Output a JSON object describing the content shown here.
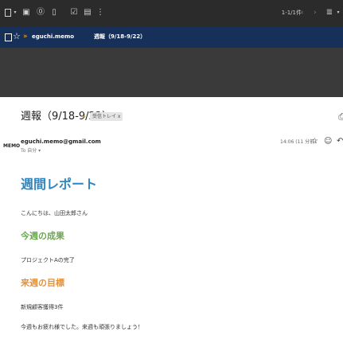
{
  "toolbar": {
    "pager_text": "1-1/1件",
    "prev_icon": "chevron-left-icon",
    "next_icon": "chevron-right-icon",
    "density_icon": "view-density-icon"
  },
  "selected_row": {
    "sender": "eguchi.memo",
    "subject": "週報（9/18-9/22）",
    "importance_marker": "»"
  },
  "email": {
    "subject": "週報（9/18-9/22）",
    "label_chip": "受信トレイ x",
    "importance_marker": "»",
    "avatar_text": "MEMO",
    "sender_email": "eguchi.memo@gmail.com",
    "to_line": "To 自分 ▾",
    "time": "14:06 (11 分前)",
    "body": {
      "heading": "週間レポート",
      "greeting": "こんにちは、山田太郎さん",
      "section1_heading": "今週の成果",
      "section1_text": "プロジェクトAの完了",
      "section2_heading": "来週の目標",
      "section2_text": "新規顧客獲得3件",
      "closing": "今週もお疲れ様でした。来週も頑張りましょう！"
    }
  },
  "colors": {
    "toolbar_bg": "#2b2b2b",
    "selected_row_bg": "#17305a",
    "heading_blue": "#2e86c1",
    "heading_green": "#6aa84f",
    "heading_orange": "#e69138",
    "importance_yellow": "#f2b33d"
  }
}
